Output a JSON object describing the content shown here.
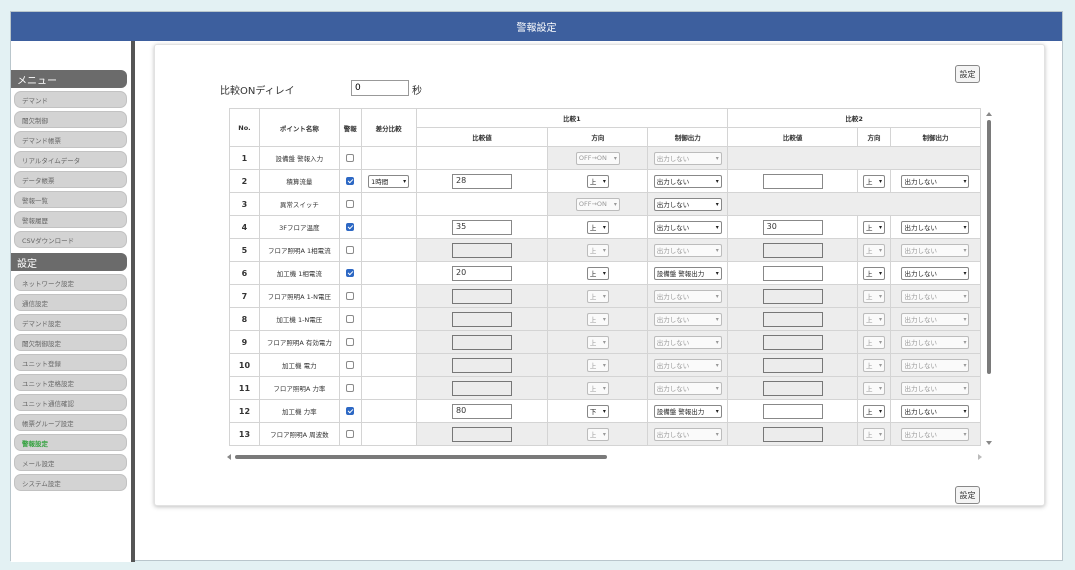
{
  "title": "警報設定",
  "sidebar": {
    "menu_header": "メニュー",
    "menu_items": [
      "デマンド",
      "閾欠制御",
      "デマンド帳票",
      "リアルタイムデータ",
      "データ帳票",
      "警報一覧",
      "警報履歴",
      "CSVダウンロード"
    ],
    "settings_header": "設定",
    "settings_items": [
      "ネットワーク設定",
      "通信設定",
      "デマンド設定",
      "閾欠制御設定",
      "ユニット登録",
      "ユニット定格設定",
      "ユニット通信確認",
      "帳票グループ設定",
      "警報設定",
      "メール設定",
      "システム設定"
    ],
    "active_item": "警報設定"
  },
  "buttons": {
    "set_label": "設定"
  },
  "delay": {
    "label": "比較ONディレイ",
    "value": "0",
    "unit": "秒"
  },
  "table": {
    "group1": "比較1",
    "group2": "比較2",
    "headers": {
      "no": "No.",
      "point": "ポイント名称",
      "alarm": "警報",
      "diff": "差分比較",
      "value": "比較値",
      "direction": "方向",
      "output": "制御出力"
    },
    "rows": [
      {
        "no": "1",
        "name": "設備盤 警報入力",
        "alarm": false,
        "diff": "",
        "v1": null,
        "dir1": "OFF→ON",
        "dir1_disabled": true,
        "out1": "出力しない",
        "out1_disabled": true,
        "type": "digital"
      },
      {
        "no": "2",
        "name": "積算流量",
        "alarm": true,
        "diff": "1時間",
        "v1": "28",
        "dir1": "上",
        "dir1_disabled": false,
        "out1": "出力しない",
        "out1_disabled": false,
        "v2": "",
        "v2_disabled": false,
        "dir2": "上",
        "dir2_disabled": false,
        "out2": "出力しない",
        "out2_disabled": false,
        "type": "analog"
      },
      {
        "no": "3",
        "name": "異常スイッチ",
        "alarm": false,
        "diff": "",
        "v1": null,
        "dir1": "OFF→ON",
        "dir1_disabled": true,
        "out1": "出力しない",
        "out1_disabled": false,
        "type": "digital"
      },
      {
        "no": "4",
        "name": "3Fフロア温度",
        "alarm": true,
        "diff": "",
        "v1": "35",
        "dir1": "上",
        "dir1_disabled": false,
        "out1": "出力しない",
        "out1_disabled": false,
        "v2": "30",
        "v2_disabled": false,
        "dir2": "上",
        "dir2_disabled": false,
        "out2": "出力しない",
        "out2_disabled": false,
        "type": "analog"
      },
      {
        "no": "5",
        "name": "フロア照明A 1相電流",
        "alarm": false,
        "diff": "",
        "v1": "",
        "v1_disabled": true,
        "dir1": "上",
        "dir1_disabled": true,
        "out1": "出力しない",
        "out1_disabled": true,
        "v2": "",
        "v2_disabled": true,
        "dir2": "上",
        "dir2_disabled": true,
        "out2": "出力しない",
        "out2_disabled": true,
        "type": "analog"
      },
      {
        "no": "6",
        "name": "加工機 1相電流",
        "alarm": true,
        "diff": "",
        "v1": "20",
        "dir1": "上",
        "dir1_disabled": false,
        "out1": "設備盤 警報出力",
        "out1_disabled": false,
        "v2": "",
        "v2_disabled": false,
        "dir2": "上",
        "dir2_disabled": false,
        "out2": "出力しない",
        "out2_disabled": false,
        "type": "analog"
      },
      {
        "no": "7",
        "name": "フロア照明A 1-N電圧",
        "alarm": false,
        "diff": "",
        "v1": "",
        "v1_disabled": true,
        "dir1": "上",
        "dir1_disabled": true,
        "out1": "出力しない",
        "out1_disabled": true,
        "v2": "",
        "v2_disabled": true,
        "dir2": "上",
        "dir2_disabled": true,
        "out2": "出力しない",
        "out2_disabled": true,
        "type": "analog"
      },
      {
        "no": "8",
        "name": "加工機 1-N電圧",
        "alarm": false,
        "diff": "",
        "v1": "",
        "v1_disabled": true,
        "dir1": "上",
        "dir1_disabled": true,
        "out1": "出力しない",
        "out1_disabled": true,
        "v2": "",
        "v2_disabled": true,
        "dir2": "上",
        "dir2_disabled": true,
        "out2": "出力しない",
        "out2_disabled": true,
        "type": "analog"
      },
      {
        "no": "9",
        "name": "フロア照明A 有効電力",
        "alarm": false,
        "diff": "",
        "v1": "",
        "v1_disabled": true,
        "dir1": "上",
        "dir1_disabled": true,
        "out1": "出力しない",
        "out1_disabled": true,
        "v2": "",
        "v2_disabled": true,
        "dir2": "上",
        "dir2_disabled": true,
        "out2": "出力しない",
        "out2_disabled": true,
        "type": "analog"
      },
      {
        "no": "10",
        "name": "加工機 電力",
        "alarm": false,
        "diff": "",
        "v1": "",
        "v1_disabled": true,
        "dir1": "上",
        "dir1_disabled": true,
        "out1": "出力しない",
        "out1_disabled": true,
        "v2": "",
        "v2_disabled": true,
        "dir2": "上",
        "dir2_disabled": true,
        "out2": "出力しない",
        "out2_disabled": true,
        "type": "analog"
      },
      {
        "no": "11",
        "name": "フロア照明A 力率",
        "alarm": false,
        "diff": "",
        "v1": "",
        "v1_disabled": true,
        "dir1": "上",
        "dir1_disabled": true,
        "out1": "出力しない",
        "out1_disabled": true,
        "v2": "",
        "v2_disabled": true,
        "dir2": "上",
        "dir2_disabled": true,
        "out2": "出力しない",
        "out2_disabled": true,
        "type": "analog"
      },
      {
        "no": "12",
        "name": "加工機 力率",
        "alarm": true,
        "diff": "",
        "v1": "80",
        "dir1": "下",
        "dir1_disabled": false,
        "out1": "設備盤 警報出力",
        "out1_disabled": false,
        "v2": "",
        "v2_disabled": false,
        "dir2": "上",
        "dir2_disabled": false,
        "out2": "出力しない",
        "out2_disabled": false,
        "type": "analog"
      },
      {
        "no": "13",
        "name": "フロア照明A 周波数",
        "alarm": false,
        "diff": "",
        "v1": "",
        "v1_disabled": true,
        "dir1": "上",
        "dir1_disabled": true,
        "out1": "出力しない",
        "out1_disabled": true,
        "v2": "",
        "v2_disabled": true,
        "dir2": "上",
        "dir2_disabled": true,
        "out2": "出力しない",
        "out2_disabled": true,
        "type": "analog"
      }
    ]
  },
  "colors": {
    "titlebar": "#3d5f9e",
    "checkbox_on": "#2d68c4",
    "active_nav": "#35a240"
  }
}
